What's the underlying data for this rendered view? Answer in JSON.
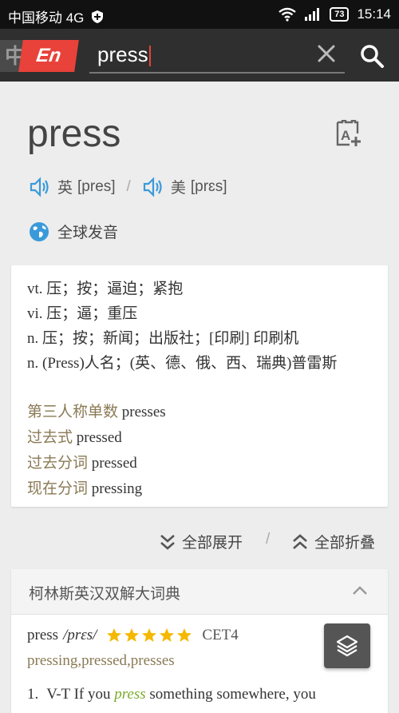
{
  "status_bar": {
    "carrier": "中国移动 4G",
    "battery": "73",
    "time": "15:14",
    "icons": [
      "shield-icon",
      "wifi-icon",
      "signal-icon",
      "battery-icon"
    ]
  },
  "search": {
    "lang_zh": "中",
    "lang_en": "En",
    "query": "press",
    "clear_icon": "close-icon",
    "search_icon": "search-icon"
  },
  "word": {
    "title": "press",
    "bookmark_icon": "add-to-wordbook-icon",
    "uk_label": "英",
    "uk_phonetic": "[pres]",
    "separator": "/",
    "us_label": "美",
    "us_phonetic": "[prɛs]",
    "global_pron": "全球发音"
  },
  "definitions": [
    "vt. 压；按；逼迫；紧抱",
    "vi. 压；逼；重压",
    "n. 压；按；新闻；出版社；[印刷] 印刷机",
    "n. (Press)人名；(英、德、俄、西、瑞典)普雷斯"
  ],
  "forms": [
    {
      "label": "第三人称单数",
      "value": "presses"
    },
    {
      "label": "过去式",
      "value": "pressed"
    },
    {
      "label": "过去分词",
      "value": "pressed"
    },
    {
      "label": "现在分词",
      "value": "pressing"
    }
  ],
  "toggles": {
    "expand_all": "全部展开",
    "separator": "/",
    "collapse_all": "全部折叠"
  },
  "collins": {
    "title": "柯林斯英汉双解大词典",
    "headword": "press",
    "phonetic": "/prɛs/",
    "stars": 5,
    "level": "CET4",
    "inflections": "pressing,pressed,presses",
    "example_num": "1.",
    "example_pre": "V-T If you",
    "example_hl": "press",
    "example_post": "something somewhere, you"
  },
  "colors": {
    "accent_red": "#e8423a",
    "icon_blue": "#3a9ad9",
    "star_gold": "#f5b800",
    "highlight_green": "#7aaa2a"
  }
}
